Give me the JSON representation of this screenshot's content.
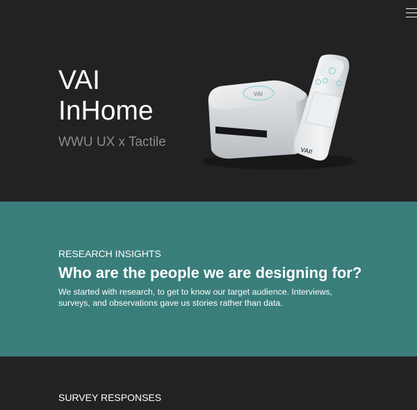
{
  "hero": {
    "title_line1": "VAI",
    "title_line2": "InHome",
    "subtitle": "WWU UX x Tactile",
    "device_logo": "VAI",
    "remote_logo": "VAI!",
    "menu_icon": "hamburger-menu-icon"
  },
  "research": {
    "eyebrow": "RESEARCH INSIGHTS",
    "heading": "Who are the people we are designing for?",
    "body": "We started with research, to get to know our target audience. Interviews, surveys, and observations gave us stories rather than data."
  },
  "survey": {
    "title": "SURVEY RESPONSES"
  },
  "colors": {
    "dark_bg": "#222223",
    "teal_bg": "#3a7e7b",
    "subtitle_gray": "#8c8c8c"
  }
}
